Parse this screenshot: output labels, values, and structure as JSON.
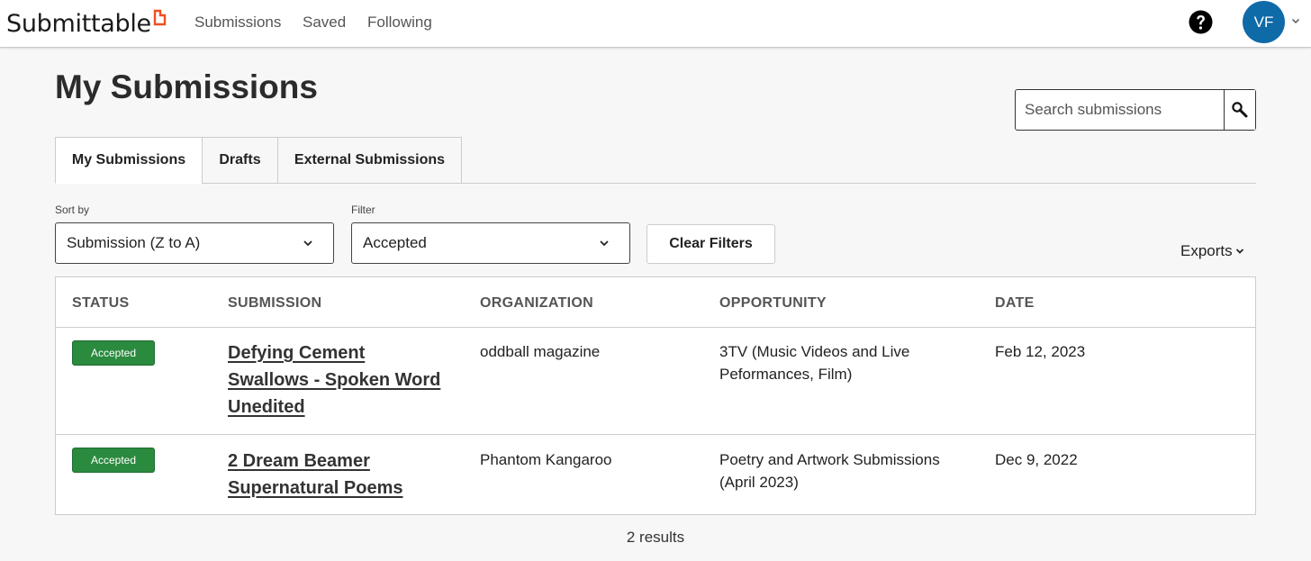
{
  "app": {
    "name": "Submittable",
    "brand_color": "#f04e23"
  },
  "nav": {
    "links": [
      "Submissions",
      "Saved",
      "Following"
    ],
    "help_icon": "question-circle-icon",
    "avatar_initials": "VF",
    "avatar_color": "#0f6aa8"
  },
  "page": {
    "title": "My Submissions"
  },
  "search": {
    "placeholder": "Search submissions",
    "icon": "search-icon"
  },
  "tabs": [
    {
      "label": "My Submissions",
      "active": true
    },
    {
      "label": "Drafts",
      "active": false
    },
    {
      "label": "External Submissions",
      "active": false
    }
  ],
  "filters": {
    "sort_label": "Sort by",
    "sort_value": "Submission (Z to A)",
    "filter_label": "Filter",
    "filter_value": "Accepted",
    "clear_label": "Clear Filters",
    "exports_label": "Exports"
  },
  "table": {
    "columns": [
      "STATUS",
      "SUBMISSION",
      "ORGANIZATION",
      "OPPORTUNITY",
      "DATE"
    ],
    "rows": [
      {
        "status": "Accepted",
        "submission_lines": [
          "Defying Cement",
          "Swallows - Spoken Word",
          "Unedited"
        ],
        "organization": "oddball magazine",
        "opportunity_lines": [
          "3TV (Music Videos and Live",
          "Peformances, Film)"
        ],
        "date": "Feb 12, 2023"
      },
      {
        "status": "Accepted",
        "submission_lines": [
          "2 Dream Beamer",
          "Supernatural Poems"
        ],
        "organization": "Phantom Kangaroo",
        "opportunity_lines": [
          "Poetry and Artwork Submissions",
          "(April 2023)"
        ],
        "date": "Dec 9, 2022"
      }
    ],
    "status_color": "#2a8a3e"
  },
  "results_text": "2 results"
}
